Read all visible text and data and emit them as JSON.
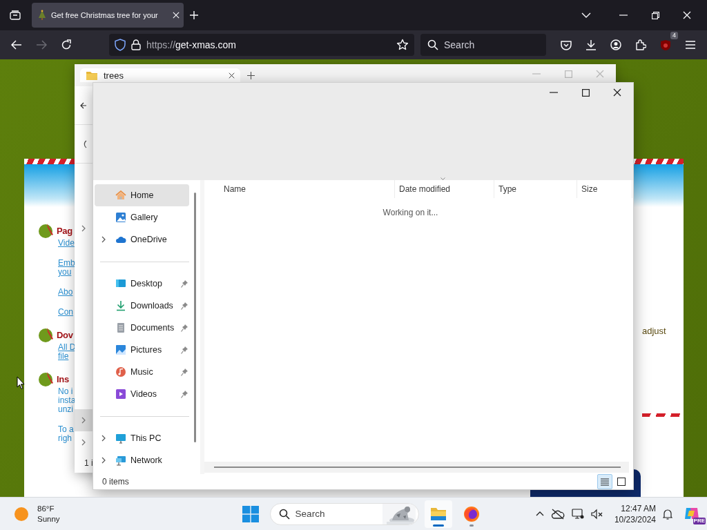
{
  "browser": {
    "tab": {
      "title": "Get free Christmas tree for your",
      "selected": true
    },
    "address": {
      "scheme": "https://",
      "host": "get-xmas.com"
    },
    "search": {
      "placeholder": "Search"
    },
    "extension_badge": "4"
  },
  "web_page": {
    "sections": [
      {
        "heading": "Pag",
        "items": [
          {
            "kind": "link",
            "lines": [
              "Vide"
            ]
          },
          {
            "kind": "link",
            "lines": [
              "Emb",
              "you"
            ]
          },
          {
            "kind": "link",
            "lines": [
              "Abo"
            ]
          },
          {
            "kind": "link",
            "lines": [
              "Con"
            ]
          }
        ]
      },
      {
        "heading": "Dov",
        "items": [
          {
            "kind": "link",
            "lines": [
              "All D",
              "file"
            ]
          }
        ]
      },
      {
        "heading": "Ins",
        "items": [
          {
            "kind": "text",
            "lines": [
              "No i",
              "insta",
              "unzi"
            ]
          },
          {
            "kind": "text",
            "lines": [
              "To a",
              "righ"
            ]
          }
        ]
      }
    ],
    "side_text": "adjust"
  },
  "back_window": {
    "tab": {
      "title": "trees"
    },
    "status": "1 i"
  },
  "explorer": {
    "sidebar": [
      {
        "items": [
          {
            "label": "Home",
            "kind": "home",
            "selected": true,
            "expandable": false,
            "pinned": false
          },
          {
            "label": "Gallery",
            "kind": "gallery",
            "selected": false,
            "expandable": false,
            "pinned": false
          },
          {
            "label": "OneDrive",
            "kind": "cloud",
            "selected": false,
            "expandable": true,
            "pinned": false
          }
        ]
      },
      {
        "items": [
          {
            "label": "Desktop",
            "kind": "desktop",
            "selected": false,
            "expandable": false,
            "pinned": true
          },
          {
            "label": "Downloads",
            "kind": "download",
            "selected": false,
            "expandable": false,
            "pinned": true
          },
          {
            "label": "Documents",
            "kind": "document",
            "selected": false,
            "expandable": false,
            "pinned": true
          },
          {
            "label": "Pictures",
            "kind": "pictures",
            "selected": false,
            "expandable": false,
            "pinned": true
          },
          {
            "label": "Music",
            "kind": "music",
            "selected": false,
            "expandable": false,
            "pinned": true
          },
          {
            "label": "Videos",
            "kind": "video",
            "selected": false,
            "expandable": false,
            "pinned": true
          }
        ]
      },
      {
        "items": [
          {
            "label": "This PC",
            "kind": "pc",
            "selected": false,
            "expandable": true,
            "pinned": false
          },
          {
            "label": "Network",
            "kind": "network",
            "selected": false,
            "expandable": true,
            "pinned": false
          }
        ]
      }
    ],
    "columns": [
      "Name",
      "Date modified",
      "Type",
      "Size"
    ],
    "message": "Working on it...",
    "status": "0 items",
    "views": [
      {
        "kind": "details",
        "selected": true
      },
      {
        "kind": "tiles",
        "selected": false
      }
    ]
  },
  "taskbar": {
    "weather": {
      "temperature": "86°F",
      "condition": "Sunny"
    },
    "search": {
      "placeholder": "Search"
    },
    "apps": [
      {
        "kind": "explorer",
        "active": true
      },
      {
        "kind": "firefox",
        "active": false
      }
    ],
    "clock": {
      "time": "12:47 AM",
      "date": "10/23/2024"
    },
    "copilot_badge": "PRE"
  }
}
